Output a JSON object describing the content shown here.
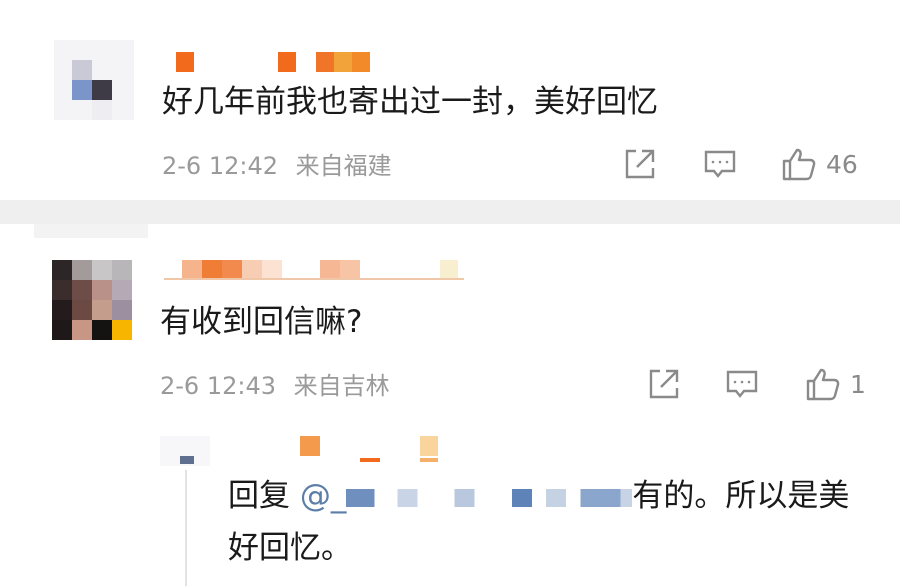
{
  "comments": [
    {
      "text": "好几年前我也寄出过一封，美好回忆",
      "date": "2-6 12:42",
      "location": "来自福建",
      "likes": "46"
    },
    {
      "text": "有收到回信嘛?",
      "date": "2-6 12:43",
      "location": "来自吉林",
      "likes": "1"
    }
  ],
  "reply": {
    "prefix": "回复",
    "mention": "@_",
    "text_line1": "有的。所以是美",
    "text_line2": "好回忆。"
  },
  "colors": {
    "text": "#1a1a1a",
    "meta": "#9a9a9a",
    "mention": "#5b7ea8",
    "divider": "#efefef"
  },
  "icons": [
    "share-icon",
    "comment-icon",
    "like-icon"
  ]
}
